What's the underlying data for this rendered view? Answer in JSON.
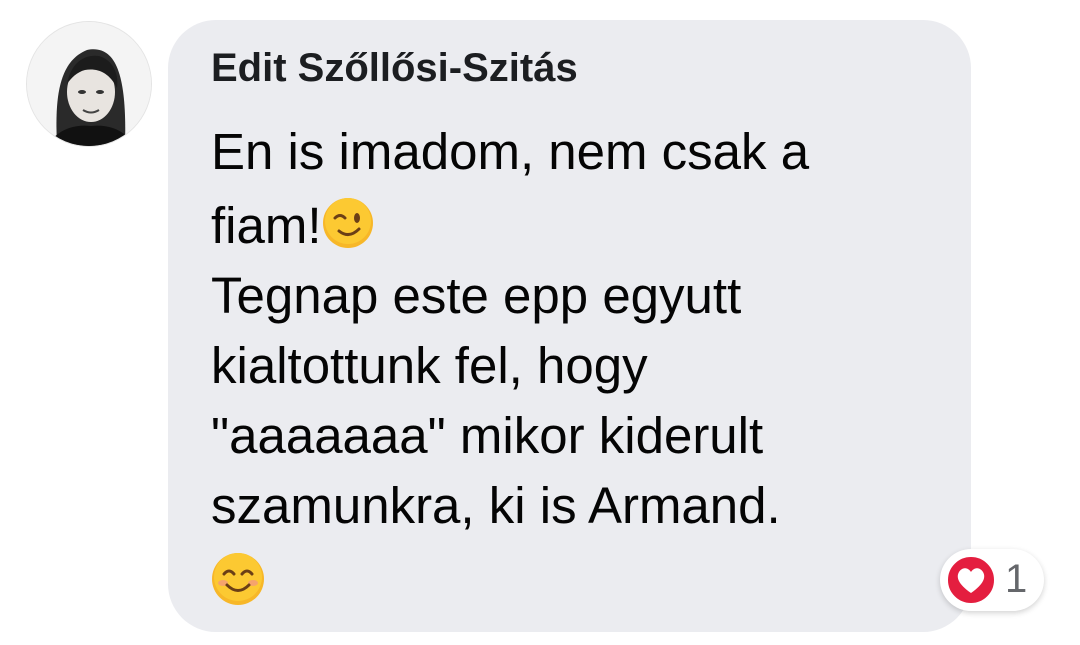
{
  "comment": {
    "author": "Edit Szőllősi-Szitás",
    "lines": [
      "En is imadom, nem csak a",
      "fiam!",
      "Tegnap este epp egyutt",
      "kialtottunk fel, hogy",
      "\"aaaaaaa\" mikor kiderult",
      "szamunkra, ki is Armand."
    ],
    "emojis": [
      "winking-face-emoji",
      "smiling-face-emoji"
    ]
  },
  "reactions": {
    "type": "love",
    "count": "1"
  },
  "colors": {
    "bubble": "#ebecf0",
    "text": "#050505",
    "heart": "#e41e3f",
    "count": "#65676b"
  }
}
